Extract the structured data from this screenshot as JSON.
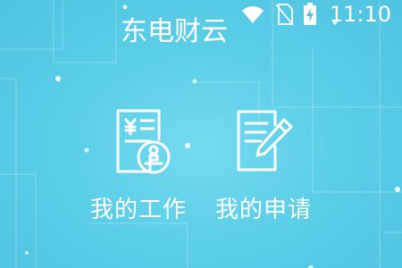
{
  "status_bar": {
    "time": "11:10",
    "icons": [
      "wifi-icon",
      "no-sim-icon",
      "battery-charging-icon"
    ]
  },
  "app": {
    "title": "东电财云"
  },
  "tiles": [
    {
      "label": "我的工作",
      "icon": "invoice-stamp-icon"
    },
    {
      "label": "我的申请",
      "icon": "document-pen-icon"
    }
  ],
  "colors": {
    "background": "#5ccfe8",
    "foreground": "#ffffff"
  }
}
